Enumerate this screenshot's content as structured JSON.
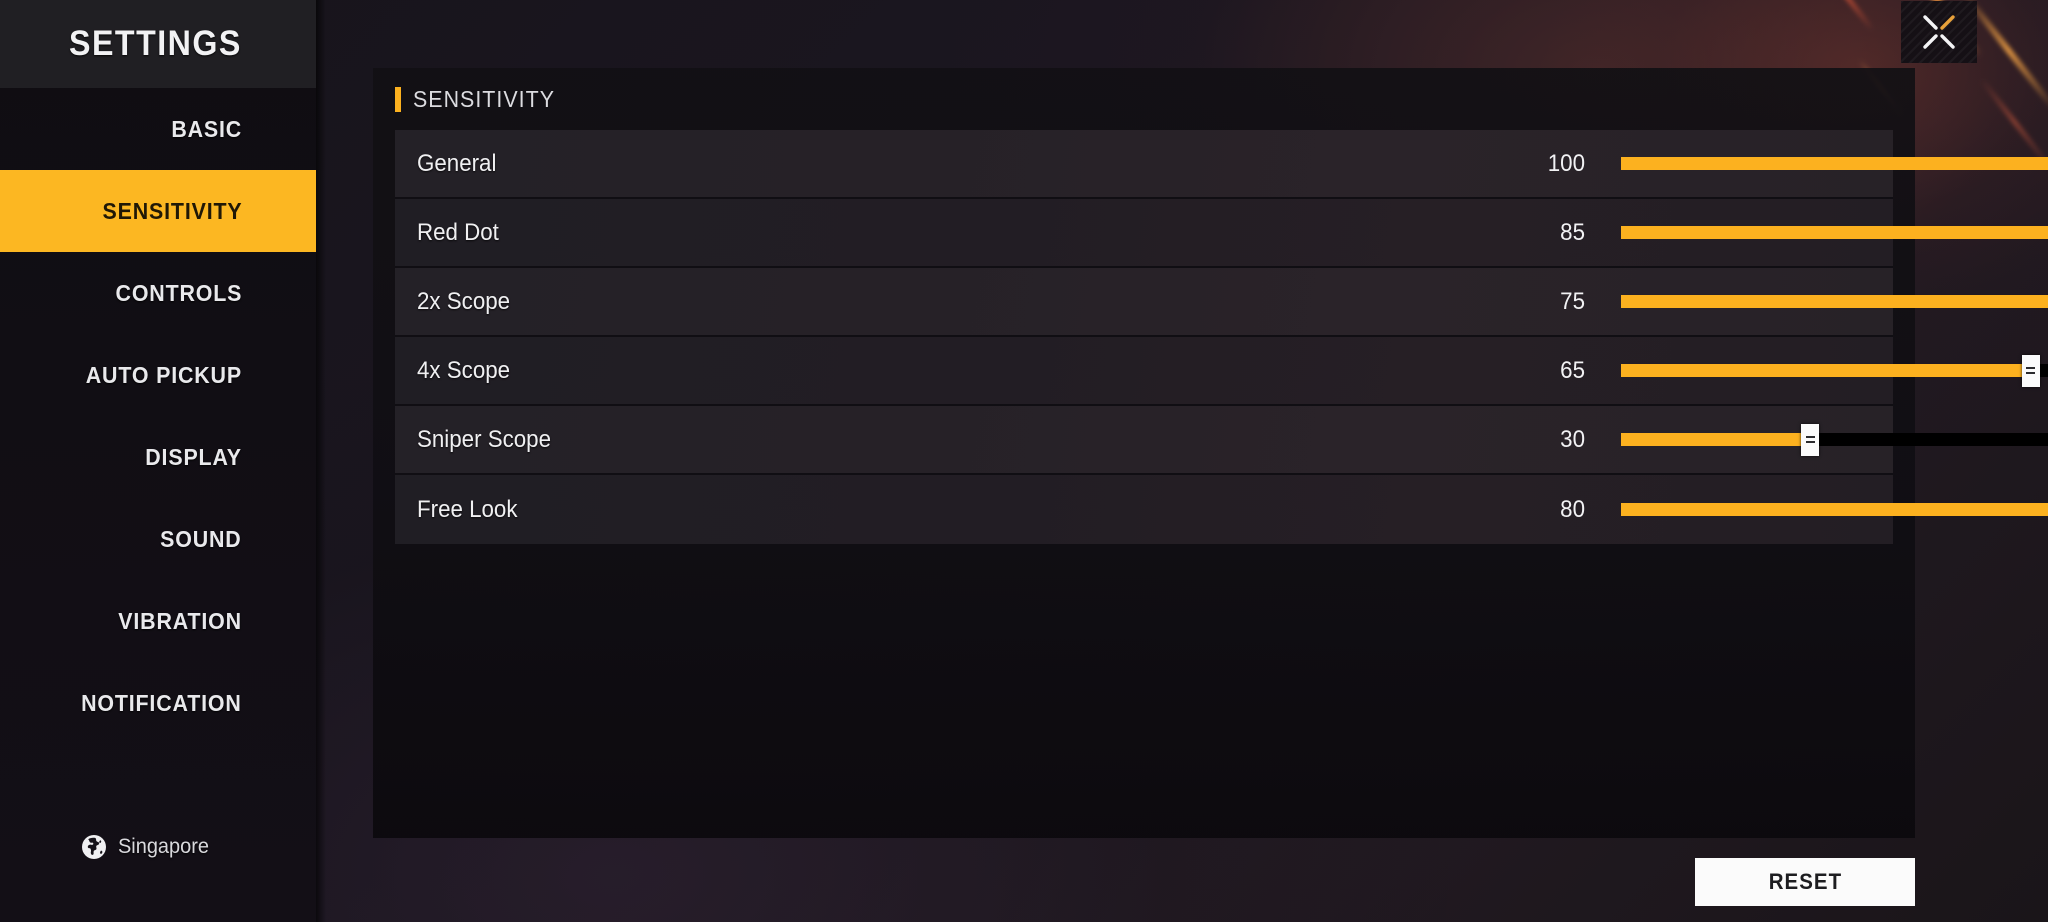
{
  "sidebar": {
    "title": "SETTINGS",
    "items": [
      {
        "label": "BASIC",
        "active": false
      },
      {
        "label": "SENSITIVITY",
        "active": true
      },
      {
        "label": "CONTROLS",
        "active": false
      },
      {
        "label": "AUTO PICKUP",
        "active": false
      },
      {
        "label": "DISPLAY",
        "active": false
      },
      {
        "label": "SOUND",
        "active": false
      },
      {
        "label": "VIBRATION",
        "active": false
      },
      {
        "label": "NOTIFICATION",
        "active": false
      }
    ],
    "region": {
      "label": "Singapore",
      "icon": "globe-icon"
    }
  },
  "content": {
    "section_title": "SENSITIVITY",
    "accent_color": "#fcb11f",
    "rows": [
      {
        "label": "General",
        "value": "100",
        "percent": 100
      },
      {
        "label": "Red Dot",
        "value": "85",
        "percent": 85
      },
      {
        "label": "2x Scope",
        "value": "75",
        "percent": 75
      },
      {
        "label": "4x Scope",
        "value": "65",
        "percent": 65
      },
      {
        "label": "Sniper Scope",
        "value": "30",
        "percent": 30
      },
      {
        "label": "Free Look",
        "value": "80",
        "percent": 80
      }
    ]
  },
  "footer": {
    "reset_label": "RESET"
  },
  "titlebar": {
    "close_icon": "close-icon"
  },
  "colors": {
    "accent": "#fcb11f",
    "active_nav": "#fcb722",
    "track_empty": "#000000",
    "thumb": "#fbfbfb",
    "reset_bg": "#fbfbfb",
    "close_arm_accent": "#e8a13a"
  }
}
